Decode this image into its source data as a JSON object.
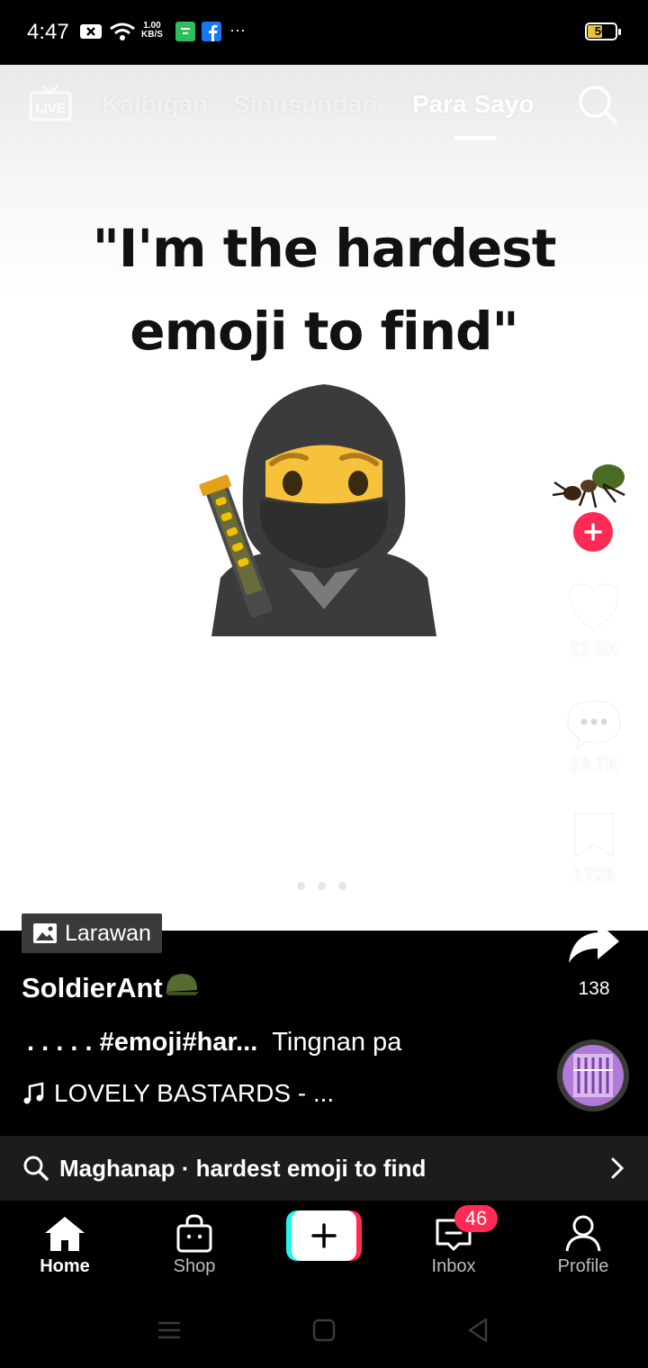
{
  "status_bar": {
    "time": "4:47",
    "net_speed_value": "1.00",
    "net_speed_unit": "KB/S",
    "battery_level": "50",
    "more": "···"
  },
  "top_nav": {
    "live_label": "LIVE",
    "tabs": [
      "Kaibigan",
      "Sinusundan",
      "Para Sayo"
    ],
    "active_tab": "Para Sayo"
  },
  "post": {
    "caption_line1": "\"I'm the hardest",
    "caption_line2": "emoji to find\"",
    "content_type_label": "Larawan",
    "author": "SoldierAnt",
    "description": ". . . . . #emoji#har...",
    "see_more": "Tingnan pa",
    "music": "LOVELY BASTARDS - ..."
  },
  "side_rail": {
    "likes": "12.5K",
    "comments": "23.7K",
    "saves": "1725",
    "shares": "138"
  },
  "search_suggestion": {
    "label": "Maghanap · hardest emoji to find"
  },
  "bottom_nav": {
    "home": "Home",
    "shop": "Shop",
    "inbox": "Inbox",
    "inbox_badge": "46",
    "profile": "Profile"
  },
  "colors": {
    "accent": "#fe2c55",
    "cyan": "#25f4ee"
  }
}
